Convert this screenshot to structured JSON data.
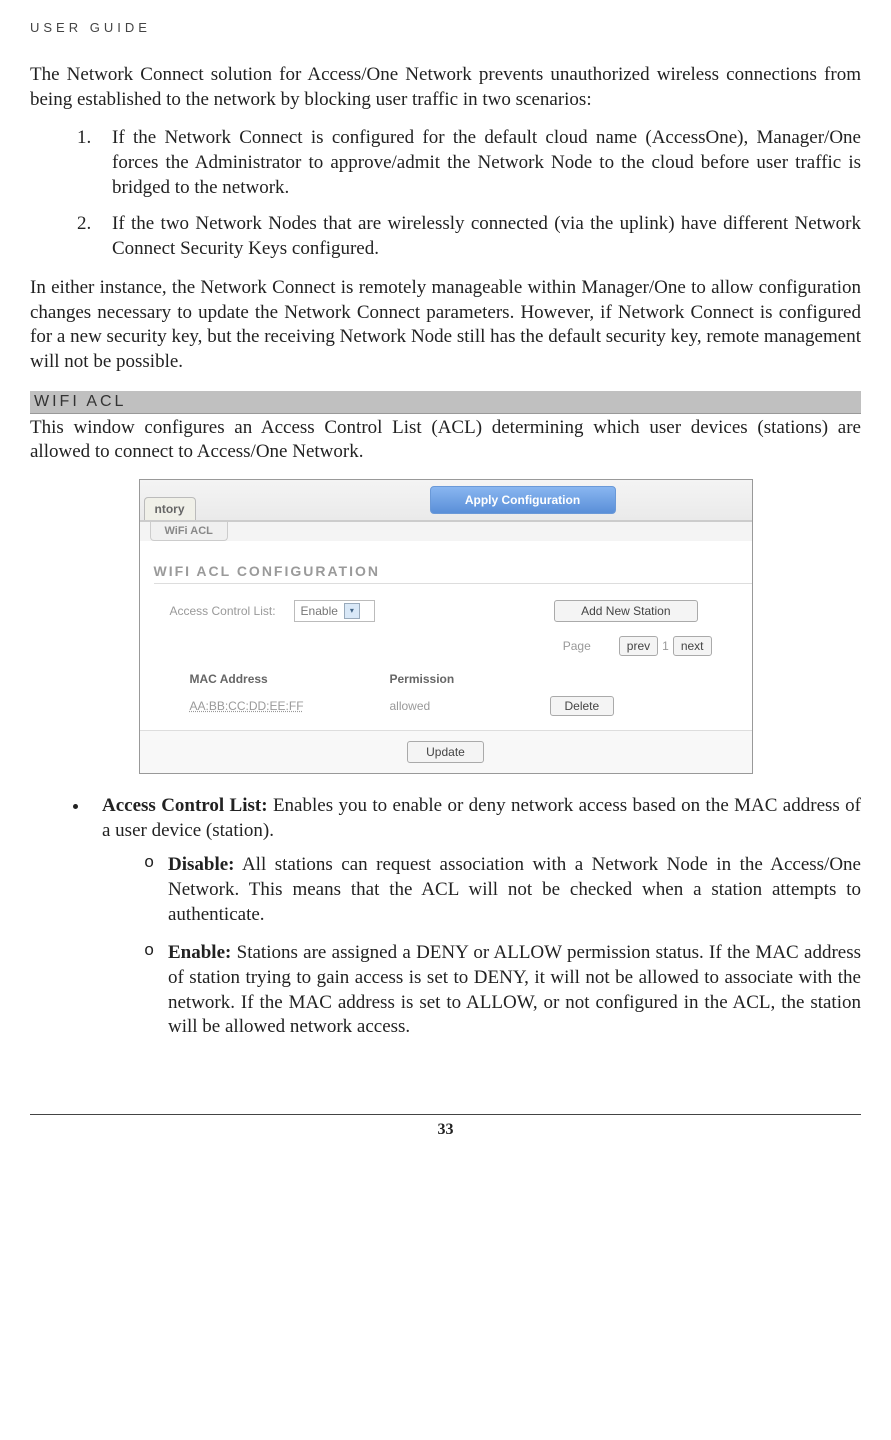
{
  "header": "USER GUIDE",
  "intro": "The Network Connect solution for Access/One Network prevents unauthorized wireless connections from being established to the network by blocking user traffic in two scenarios:",
  "scenarios": [
    "If the Network Connect is configured for the default cloud name (AccessOne), Manager/One forces the Administrator to approve/admit the Network Node to the cloud before user traffic is bridged to the network.",
    "If the two Network Nodes that are wirelessly connected (via the uplink) have different Network Connect Security Keys configured."
  ],
  "either_instance": "In either instance, the Network Connect is remotely manageable within Manager/One to allow configuration changes necessary to update the Network Connect parameters. However, if Network Connect is configured for a new security key, but the receiving Network Node still has the default security key, remote management will not be possible.",
  "section_heading": "WIFI ACL",
  "section_intro": "This window configures an Access Control List (ACL) determining which user devices (stations) are allowed to connect to Access/One Network.",
  "screenshot": {
    "tab_left": "ntory",
    "apply_button": "Apply Configuration",
    "subtab": "WiFi ACL",
    "panel_title": "WIFI ACL CONFIGURATION",
    "acl_label": "Access Control List:",
    "acl_value": "Enable",
    "add_button": "Add New Station",
    "page_label": "Page",
    "prev": "prev",
    "page_num": "1",
    "next": "next",
    "col_mac": "MAC Address",
    "col_perm": "Permission",
    "row_mac": "AA:BB:CC:DD:EE:FF",
    "row_perm": "allowed",
    "delete": "Delete",
    "update": "Update"
  },
  "bullet": {
    "acl_title": "Access Control List:",
    "acl_body": " Enables you to enable or deny network access based on the MAC address of a user device (station).",
    "disable_title": "Disable:",
    "disable_body": " All stations can request association with a Network Node in the Access/One Network. This means that the ACL will not be checked when a station attempts to authenticate.",
    "enable_title": "Enable:",
    "enable_body": " Stations are assigned a DENY or ALLOW permission status. If the MAC address of station trying to gain access is set to DENY, it will not be allowed to associate with the network. If the MAC address is set to ALLOW, or not configured in the ACL, the station will be allowed network access."
  },
  "page_number": "33"
}
